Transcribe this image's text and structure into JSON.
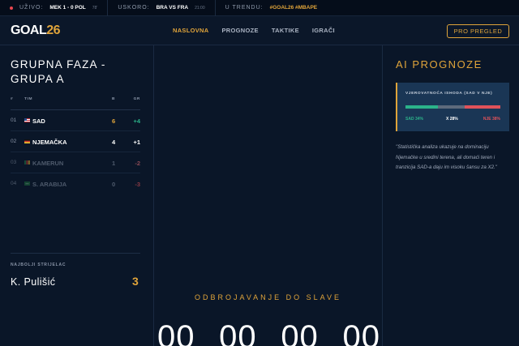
{
  "ticker": {
    "live_label": "UŽIVO:",
    "live_score": "MEK 1 - 0 POL",
    "live_minute": "78'",
    "soon_label": "USKORO:",
    "soon_match": "BRA VS FRA",
    "soon_time": "21:00",
    "trend_label": "U TRENDU:",
    "trend_tags": "#GOAL26 #MBAPE"
  },
  "nav": {
    "logo_main": "GOAL",
    "logo_accent": "26",
    "items": [
      "NASLOVNA",
      "PROGNOZE",
      "TAKTIKE",
      "IGRAČI"
    ],
    "active_index": 0,
    "pro_button": "PRO PREGLED"
  },
  "standings": {
    "title": "GRUPNA FAZA - GRUPA A",
    "headers": {
      "pos": "#",
      "team": "TIM",
      "b": "B",
      "gr": "GR"
    },
    "rows": [
      {
        "pos": "01",
        "team": "SAD",
        "b": "6",
        "gr": "+4",
        "flag": "usa-flag"
      },
      {
        "pos": "02",
        "team": "NJEMAČKA",
        "b": "4",
        "gr": "+1",
        "flag": "germany-flag"
      },
      {
        "pos": "03",
        "team": "KAMERUN",
        "b": "1",
        "gr": "-2",
        "flag": "cameroon-flag"
      },
      {
        "pos": "04",
        "team": "S. ARABIJA",
        "b": "0",
        "gr": "-3",
        "flag": "saudi-arabia-flag"
      }
    ]
  },
  "top_scorer": {
    "label": "NAJBOLJI STRIJELAC",
    "name": "K. Pulišić",
    "goals": "3"
  },
  "countdown": {
    "label": "ODBROJAVANJE DO SLAVE",
    "digits": [
      "00",
      "00",
      "00",
      "00"
    ]
  },
  "ai": {
    "title": "AI PROGNOZE",
    "card_title": "VJEROVATNOĆA ISHODA (SAD V NJE)",
    "probabilities": [
      {
        "label": "SAD 34%",
        "value": 34,
        "color": "#2bb38a"
      },
      {
        "label": "X 28%",
        "value": 28,
        "color": "#5d6a7c"
      },
      {
        "label": "NJE 38%",
        "value": 38,
        "color": "#e0525a"
      }
    ],
    "analysis": "\"Statistička analiza ukazuje na dominaciju Njemačke u sredini terena, ali domaći teren i tranzicija SAD-a daju im visoku šansu za X2.\""
  },
  "colors": {
    "accent": "#e0a43a",
    "positive": "#2bb38a",
    "negative": "#e0525a",
    "background": "#0a1628"
  }
}
